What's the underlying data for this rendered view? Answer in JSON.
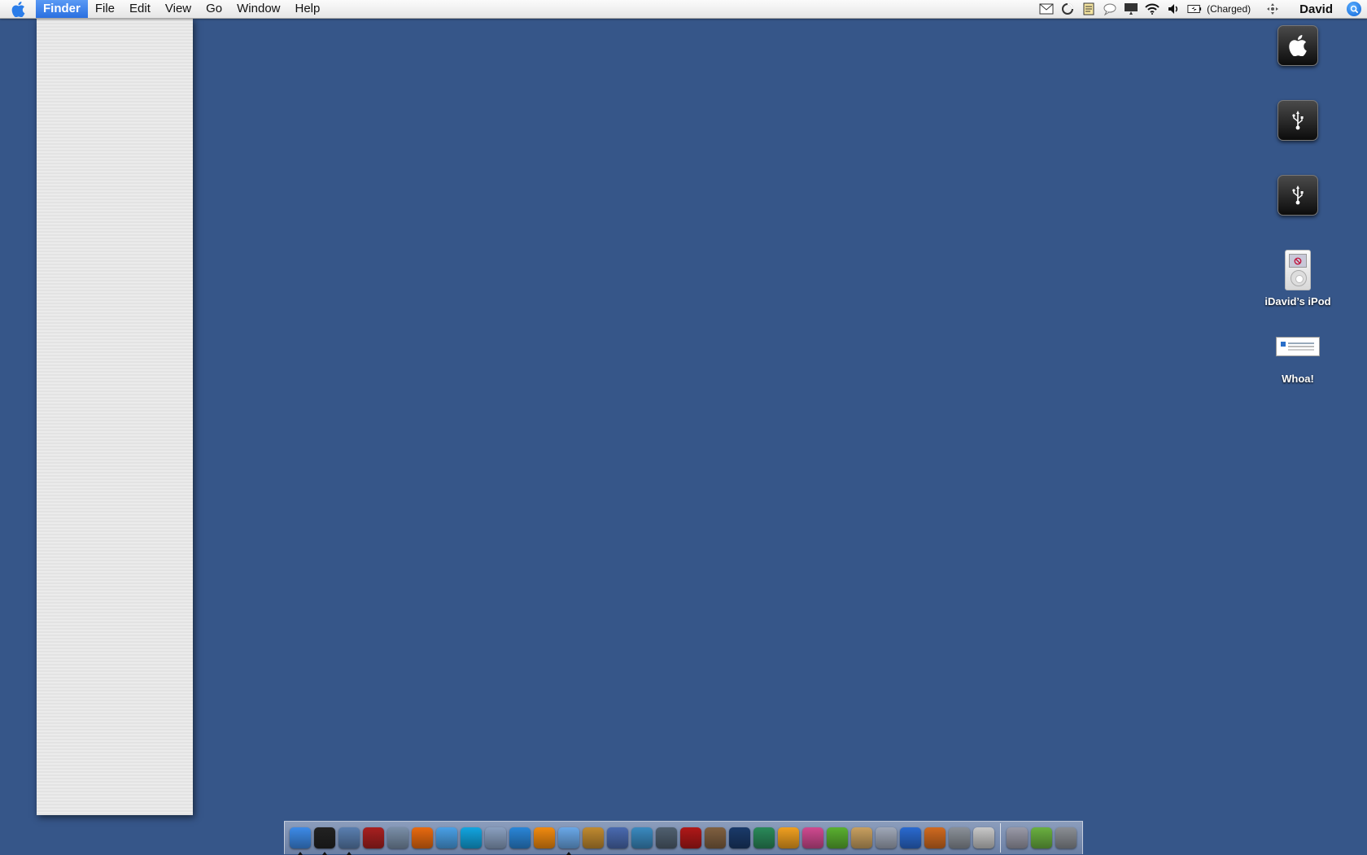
{
  "menubar": {
    "app_name": "Finder",
    "items": [
      "File",
      "Edit",
      "View",
      "Go",
      "Window",
      "Help"
    ],
    "battery_status": "(Charged)",
    "user_name": "David"
  },
  "desktop": {
    "background_color": "#365689",
    "icons": [
      {
        "label": "",
        "kind": "apple-drive"
      },
      {
        "label": "",
        "kind": "usb-drive"
      },
      {
        "label": "",
        "kind": "usb-drive"
      },
      {
        "label": "iDavid’s iPod",
        "kind": "ipod"
      },
      {
        "label": "Whoa!",
        "kind": "document"
      }
    ]
  },
  "dock": {
    "apps": [
      {
        "name": "finder-icon",
        "color": "#3d8be8",
        "running": true
      },
      {
        "name": "dashboard-icon",
        "color": "#222222",
        "running": true
      },
      {
        "name": "preview-icon",
        "color": "#5a7fb0",
        "running": true
      },
      {
        "name": "dictionary-icon",
        "color": "#a82020",
        "running": false
      },
      {
        "name": "system-preferences-icon",
        "color": "#7a8fa8",
        "running": false
      },
      {
        "name": "firefox-icon",
        "color": "#e86a10",
        "running": false
      },
      {
        "name": "ichat-icon",
        "color": "#4aa0e6",
        "running": false
      },
      {
        "name": "skype-icon",
        "color": "#12a5e0",
        "running": false
      },
      {
        "name": "folder-app-icon",
        "color": "#8aa0c0",
        "running": false
      },
      {
        "name": "quicktime-icon",
        "color": "#2a86d8",
        "running": false
      },
      {
        "name": "vlc-icon",
        "color": "#f08a10",
        "running": false
      },
      {
        "name": "itunes-icon",
        "color": "#6aa8e8",
        "running": true
      },
      {
        "name": "garageband-icon",
        "color": "#c08a30",
        "running": false
      },
      {
        "name": "imovie-icon",
        "color": "#4a6ab0",
        "running": false
      },
      {
        "name": "iphoto-icon",
        "color": "#3a8ac0",
        "running": false
      },
      {
        "name": "photo-booth-icon",
        "color": "#506070",
        "running": false
      },
      {
        "name": "red-app-icon",
        "color": "#b01818",
        "running": false
      },
      {
        "name": "iweb-icon",
        "color": "#806040",
        "running": false
      },
      {
        "name": "photoshop-icon",
        "color": "#1a3a6a",
        "running": false
      },
      {
        "name": "feather-app-icon",
        "color": "#2a8a5a",
        "running": false
      },
      {
        "name": "flower-app-icon",
        "color": "#f0a020",
        "running": false
      },
      {
        "name": "pinwheel-icon",
        "color": "#d04a90",
        "running": false
      },
      {
        "name": "dreamweaver-icon",
        "color": "#5ab030",
        "running": false
      },
      {
        "name": "notes-app-icon",
        "color": "#c8a060",
        "running": false
      },
      {
        "name": "mail-icon",
        "color": "#a0a8b8",
        "running": false
      },
      {
        "name": "word-icon",
        "color": "#2a6ad0",
        "running": false
      },
      {
        "name": "powerpoint-icon",
        "color": "#d06a20",
        "running": false
      },
      {
        "name": "utility-icon",
        "color": "#8a9098",
        "running": false
      },
      {
        "name": "apple-store-icon",
        "color": "#c8c8c8",
        "running": false
      }
    ],
    "others": [
      {
        "name": "applications-stack-icon",
        "color": "#9a9aa8"
      },
      {
        "name": "images-stack-icon",
        "color": "#6ab040"
      },
      {
        "name": "trash-icon",
        "color": "#8a8e94"
      }
    ]
  }
}
